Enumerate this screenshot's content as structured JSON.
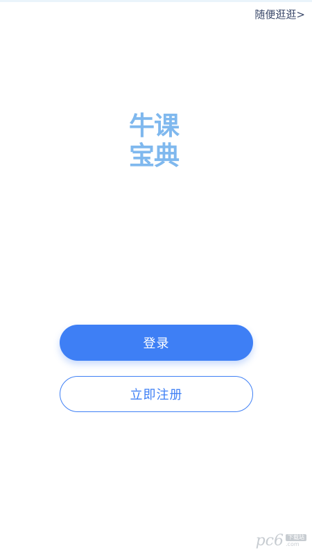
{
  "header": {
    "browse_label": "随便逛逛>"
  },
  "logo": {
    "line1": "牛课",
    "line2": "宝典"
  },
  "actions": {
    "login_label": "登录",
    "register_label": "立即注册"
  },
  "watermark": {
    "mark": "pc6",
    "badge": "下载站",
    "domain": ".com"
  },
  "colors": {
    "primary": "#3e7ff5",
    "logo": "#7fb8ee",
    "link_text": "#3c4a6b",
    "background": "#ffffff"
  }
}
